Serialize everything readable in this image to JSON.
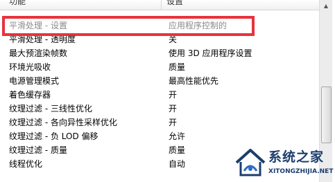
{
  "header": {
    "col_feature": "功能",
    "col_setting": "设置"
  },
  "rows": [
    {
      "feature": "平滑处理 - 设置",
      "setting": "应用程序控制的",
      "disabled": true
    },
    {
      "feature": "平滑处理 - 透明度",
      "setting": "关"
    },
    {
      "feature": "最大预渲染帧数",
      "setting": "使用 3D 应用程序设置"
    },
    {
      "feature": "环境光吸收",
      "setting": "质量"
    },
    {
      "feature": "电源管理模式",
      "setting": "最高性能优先"
    },
    {
      "feature": "着色缓存器",
      "setting": "开"
    },
    {
      "feature": "纹理过滤 - 三线性优化",
      "setting": "开"
    },
    {
      "feature": "纹理过滤 - 各向异性采样优化",
      "setting": "开"
    },
    {
      "feature": "纹理过滤 - 负 LOD 偏移",
      "setting": "允许"
    },
    {
      "feature": "纹理过滤 - 质量",
      "setting": "质量"
    },
    {
      "feature": "线程优化",
      "setting": "自动"
    }
  ],
  "watermark": {
    "title": "系统之家",
    "url": "XITONGZHIJIA.NET"
  },
  "colors": {
    "highlight": "#e8323c",
    "watermark": "#1c3d6e",
    "disabled_text": "#8a8a8a"
  },
  "icons": {
    "scroll_up": "triangle-up-icon",
    "watermark_logo": "house-logo-icon"
  }
}
